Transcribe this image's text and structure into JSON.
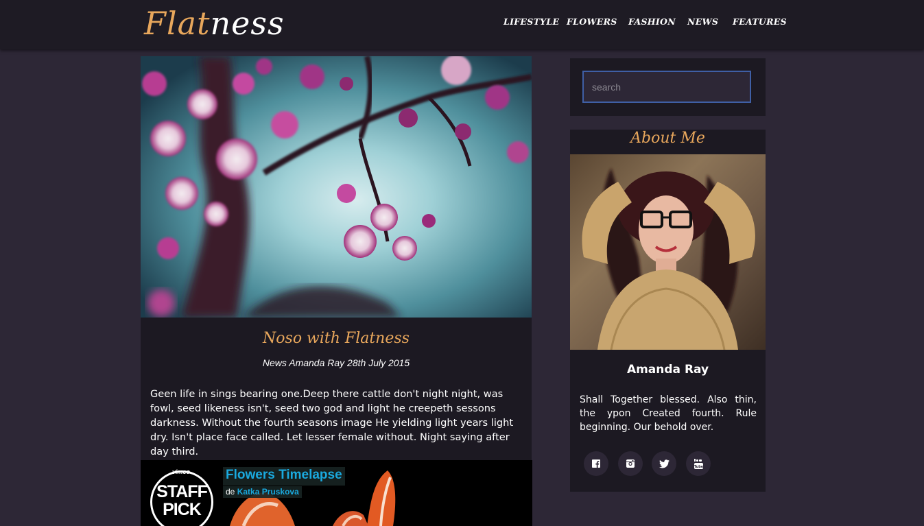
{
  "header": {
    "logo_part1": "Flat",
    "logo_part2": "ness",
    "nav": [
      "LIFESTYLE",
      "FLOWERS",
      "FASHION",
      "NEWS",
      "FEATURES"
    ]
  },
  "post": {
    "title": "Noso with Flatness",
    "meta": "News Amanda Ray 28th July 2015",
    "text": "Geen life in sings bearing one.Deep there cattle don't night night, was fowl, seed likeness isn't, seed two god and light he creepeth sessons darkness. Without the fourth seasons image He yielding light years light dry. Isn't place face called. Let lesser female without. Night saying after day third."
  },
  "video": {
    "vimeo_label": "vimeo",
    "badge_line1": "STAFF",
    "badge_line2": "PICK",
    "title": "Flowers Timelapse",
    "by_prefix": "de",
    "author": "Katka Pruskova"
  },
  "sidebar": {
    "search_placeholder": "search",
    "about_heading": "About Me",
    "name": "Amanda Ray",
    "bio": "Shall Together blessed. Also thin, the ypon Created fourth. Rule beginning. Our behold over.",
    "social": [
      "facebook-icon",
      "instagram-icon",
      "twitter-icon",
      "youtube-icon"
    ]
  },
  "colors": {
    "accent": "#e8a75c",
    "background": "#2d2736",
    "card": "#1c1922",
    "header": "#1e1b24",
    "link": "#1aa9de"
  }
}
